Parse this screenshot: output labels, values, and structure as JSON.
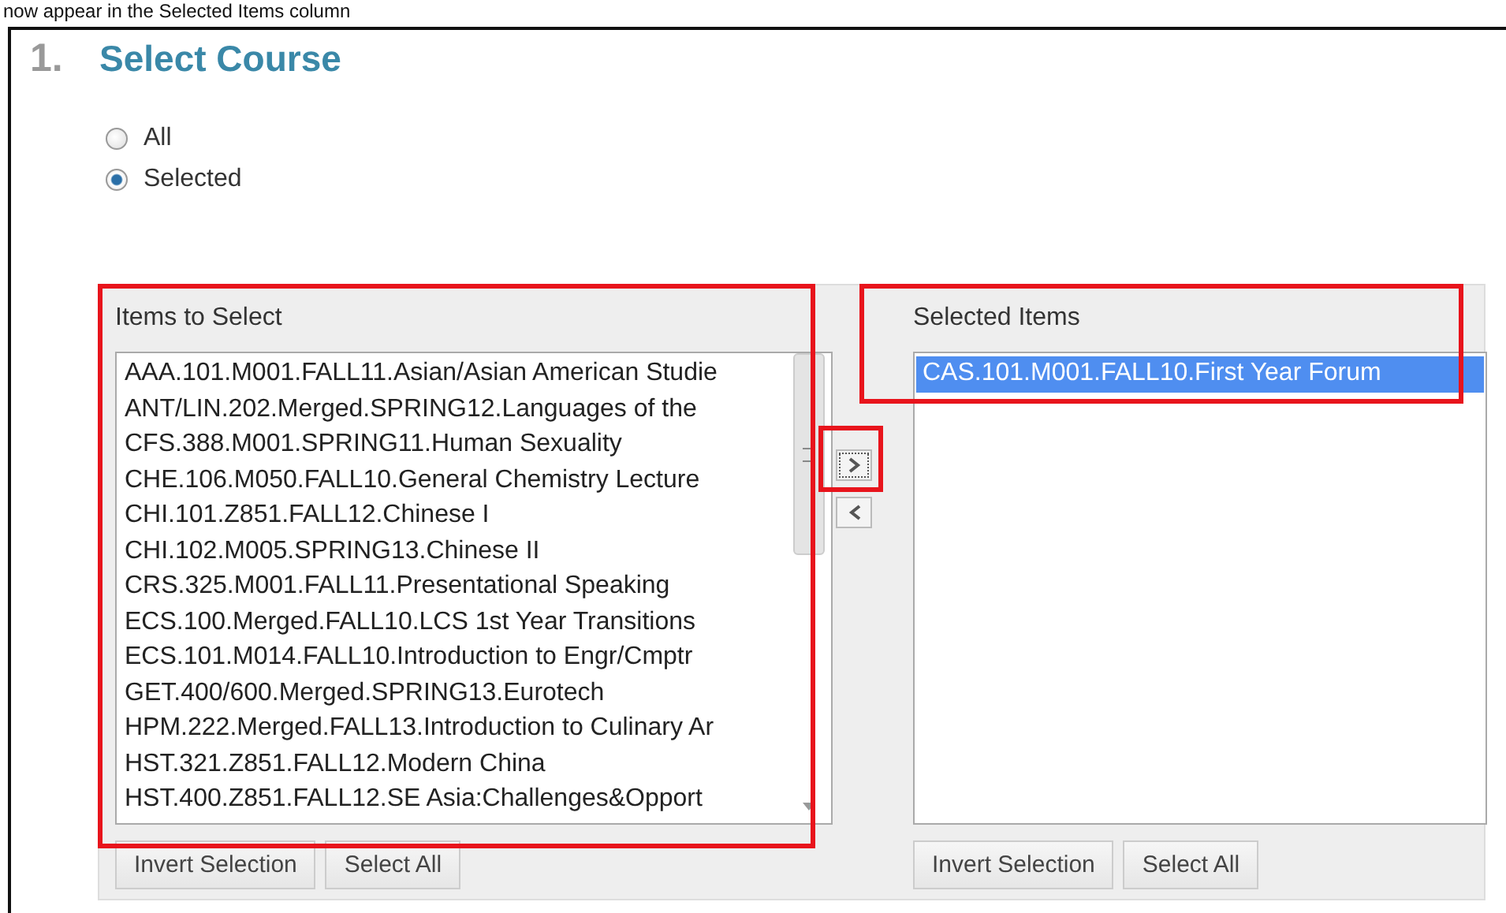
{
  "caption": "now appear in the Selected Items column",
  "step": {
    "number": "1.",
    "title": "Select Course"
  },
  "scope_options": [
    {
      "label": "All",
      "selected": false
    },
    {
      "label": "Selected",
      "selected": true
    }
  ],
  "items_to_select": {
    "title": "Items to Select",
    "items": [
      {
        "label": "AAA.101.M001.FALL11.Asian/Asian American Studie",
        "selected": false
      },
      {
        "label": "ANT/LIN.202.Merged.SPRING12.Languages of the",
        "selected": false
      },
      {
        "label": "CFS.388.M001.SPRING11.Human Sexuality",
        "selected": false
      },
      {
        "label": "CHE.106.M050.FALL10.General Chemistry Lecture",
        "selected": false
      },
      {
        "label": "CHI.101.Z851.FALL12.Chinese I",
        "selected": false
      },
      {
        "label": "CHI.102.M005.SPRING13.Chinese II",
        "selected": false
      },
      {
        "label": "CRS.325.M001.FALL11.Presentational Speaking",
        "selected": false
      },
      {
        "label": "ECS.100.Merged.FALL10.LCS 1st Year Transitions",
        "selected": false
      },
      {
        "label": "ECS.101.M014.FALL10.Introduction to Engr/Cmptr",
        "selected": false
      },
      {
        "label": "GET.400/600.Merged.SPRING13.Eurotech",
        "selected": false
      },
      {
        "label": "HPM.222.Merged.FALL13.Introduction to Culinary Ar",
        "selected": false
      },
      {
        "label": "HST.321.Z851.FALL12.Modern China",
        "selected": false
      },
      {
        "label": "HST.400.Z851.FALL12.SE Asia:Challenges&Opport",
        "selected": false
      }
    ],
    "buttons": [
      "Invert Selection",
      "Select All"
    ]
  },
  "move_buttons": [
    {
      "kind": "add"
    },
    {
      "kind": "remove"
    }
  ],
  "selected_items": {
    "title": "Selected Items",
    "items": [
      {
        "label": "CAS.101.M001.FALL10.First Year Forum",
        "selected": true
      }
    ],
    "buttons": [
      "Invert Selection",
      "Select All"
    ]
  }
}
